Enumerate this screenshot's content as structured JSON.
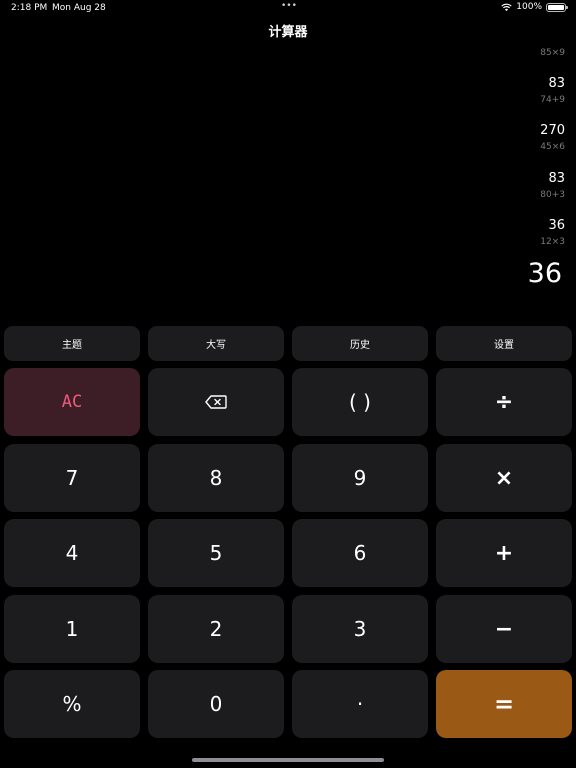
{
  "status": {
    "time": "2:18 PM",
    "date": "Mon Aug 28",
    "dots": "•••",
    "battery": "100%"
  },
  "app": {
    "title": "计算器"
  },
  "history": {
    "top_expr": "85×9",
    "entries": [
      {
        "result": "83",
        "expr": "74+9"
      },
      {
        "result": "270",
        "expr": "45×6"
      },
      {
        "result": "83",
        "expr": "80+3"
      },
      {
        "result": "36",
        "expr": "12×3"
      }
    ]
  },
  "display": {
    "value": "36"
  },
  "function_row": [
    "主题",
    "大写",
    "历史",
    "设置"
  ],
  "keys": {
    "ac": "AC",
    "paren": "( )",
    "divide": "÷",
    "seven": "7",
    "eight": "8",
    "nine": "9",
    "multiply": "×",
    "four": "4",
    "five": "5",
    "six": "6",
    "plus": "+",
    "one": "1",
    "two": "2",
    "three": "3",
    "minus": "−",
    "percent": "%",
    "zero": "0",
    "dot": "·",
    "equals": "="
  },
  "colors": {
    "background": "#000000",
    "key_bg": "#1c1c1e",
    "ac_bg": "#3d1e26",
    "ac_text": "#ec5a7b",
    "equals_bg": "#9a5a16",
    "muted_text": "#7a7a7a"
  },
  "icons": {
    "backspace": "backspace-icon",
    "wifi": "wifi-icon",
    "battery": "battery-icon"
  }
}
